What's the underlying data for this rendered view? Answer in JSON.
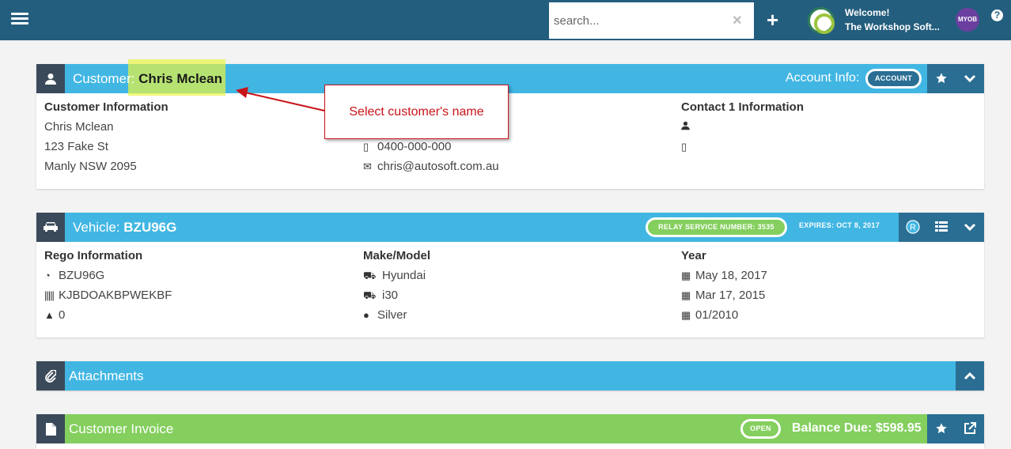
{
  "topbar": {
    "search_placeholder": "search...",
    "clear_icon": "×",
    "add_icon": "+",
    "welcome": "Welcome!",
    "company": "The Workshop Soft...",
    "myob": "MYOB",
    "help": "?"
  },
  "customer": {
    "title_label": "Customer:",
    "name": "Chris Mclean",
    "account_info_label": "Account Info:",
    "account_badge": "ACCOUNT",
    "info_heading": "Customer Information",
    "info_name": "Chris Mclean",
    "info_address1": "123 Fake St",
    "info_address2": "Manly NSW 2095",
    "phone": "0400-000-000",
    "email": "chris@autosoft.com.au",
    "contact_heading": "Contact 1 Information"
  },
  "callout": {
    "text": "Select customer's name"
  },
  "vehicle": {
    "title_label": "Vehicle:",
    "rego": "BZU96G",
    "relay_label": "RELAY SERVICE NUMBER: 3535",
    "expires_label": "EXPIRES: OCT 8, 2017",
    "rego_heading": "Rego Information",
    "rego_value": "BZU96G",
    "vin": "KJBDOAKBPWEKBF",
    "odometer": "0",
    "make_heading": "Make/Model",
    "make": "Hyundai",
    "model": "i30",
    "colour": "Silver",
    "year_heading": "Year",
    "date1": "May 18, 2017",
    "date2": "Mar 17, 2015",
    "date3": "01/2010"
  },
  "attachments": {
    "title": "Attachments"
  },
  "invoice": {
    "title": "Customer Invoice",
    "status": "OPEN",
    "balance": "Balance Due: $598.95"
  },
  "colors": {
    "topbar": "#245e7e",
    "panel_header": "#41b6e3",
    "invoice_header": "#84cf5e",
    "callout": "#c9141a",
    "highlight": "#e8f542"
  }
}
